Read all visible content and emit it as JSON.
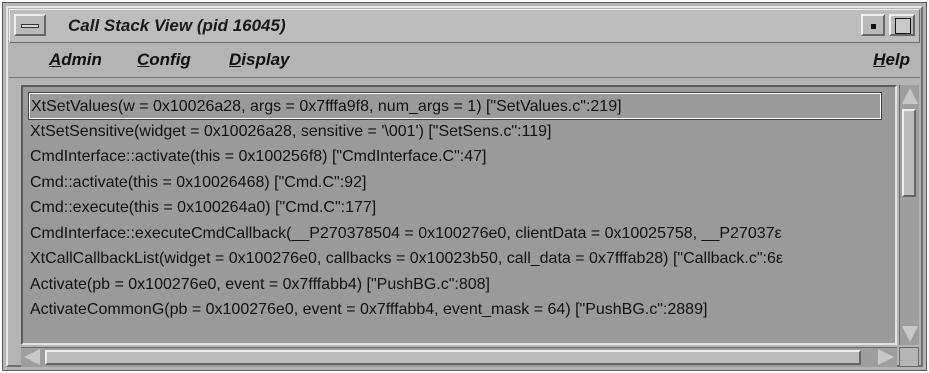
{
  "window": {
    "title": "Call Stack View (pid 16045)"
  },
  "menubar": {
    "items": [
      {
        "label": "Admin",
        "mnemonic": "A",
        "rest": "dmin"
      },
      {
        "label": "Config",
        "mnemonic": "C",
        "rest": "onfig"
      },
      {
        "label": "Display",
        "mnemonic": "D",
        "rest": "isplay"
      },
      {
        "label": "Help",
        "mnemonic": "H",
        "rest": "elp"
      }
    ]
  },
  "call_stack": {
    "selected_index": 0,
    "frames": [
      "XtSetValues(w = 0x10026a28, args = 0x7fffa9f8, num_args = 1) [\"SetValues.c\":219]",
      "XtSetSensitive(widget = 0x10026a28, sensitive = '\\001') [\"SetSens.c\":119]",
      "CmdInterface::activate(this = 0x100256f8) [\"CmdInterface.C\":47]",
      "Cmd::activate(this = 0x10026468) [\"Cmd.C\":92]",
      "Cmd::execute(this = 0x100264a0) [\"Cmd.C\":177]",
      "CmdInterface::executeCmdCallback(__P270378504 = 0x100276e0, clientData = 0x10025758, __P27037ε",
      "XtCallCallbackList(widget = 0x100276e0, callbacks = 0x10023b50, call_data = 0x7fffab28) [\"Callback.c\":6ε",
      "Activate(pb = 0x100276e0, event = 0x7fffabb4) [\"PushBG.c\":808]",
      "ActivateCommonG(pb = 0x100276e0, event = 0x7fffabb4, event_mask = 64) [\"PushBG.c\":2889]"
    ]
  }
}
